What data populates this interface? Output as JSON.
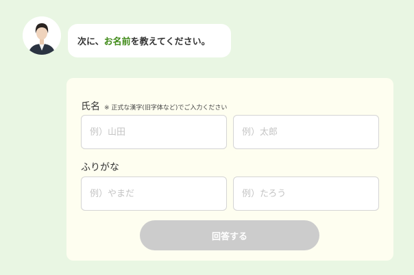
{
  "chat": {
    "message_prefix": "次に、",
    "message_highlight": "お名前",
    "message_suffix": "を教えてください。",
    "highlight_color": "#3f8a17"
  },
  "form": {
    "name_label": "氏名",
    "name_note": "※ 正式な漢字(旧字体など)でご入力ください",
    "last_name_placeholder": "例）山田",
    "first_name_placeholder": "例）太郎",
    "kana_label": "ふりがな",
    "last_kana_placeholder": "例）やまだ",
    "first_kana_placeholder": "例）たろう",
    "submit_label": "回答する",
    "submit_color_disabled": "#cccccc"
  },
  "colors": {
    "background": "#e9f6e3",
    "card": "#fefef0"
  }
}
